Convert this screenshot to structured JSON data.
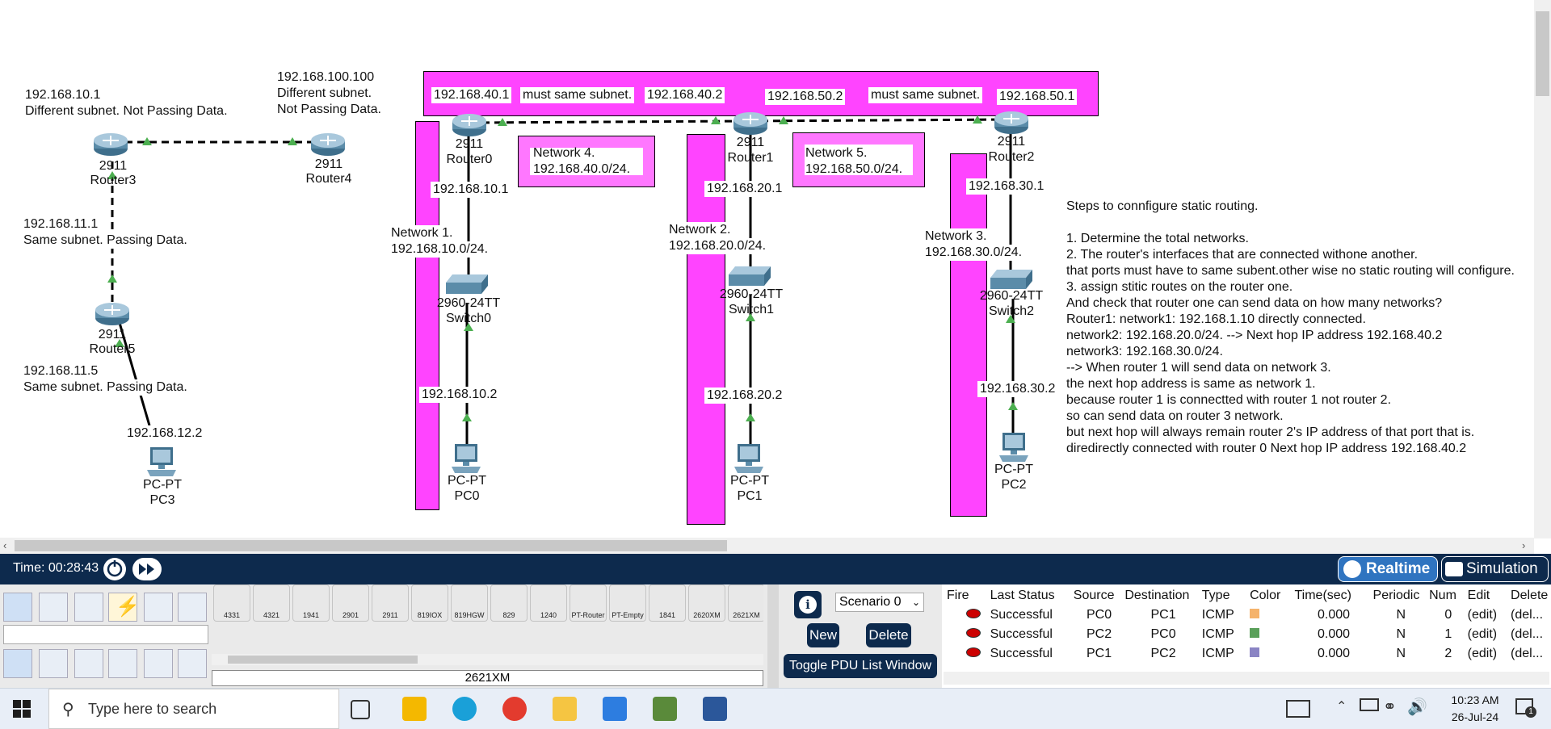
{
  "labels": {
    "r3_ip": "192.168.10.1",
    "r3_note": "Different subnet. Not Passing Data.",
    "r4_ip": "192.168.100.100",
    "r4_note1": "Different subnet.",
    "r4_note2": "Not Passing Data.",
    "r5_top_ip": "192.168.11.1",
    "r5_top_note": "Same subnet. Passing Data.",
    "r5_bot_ip": "192.168.11.5",
    "r5_bot_note": "Same subnet. Passing Data.",
    "pc3_ip": "192.168.12.2",
    "top_r0_ip": "192.168.40.1",
    "top_must1": "must same subnet.",
    "top_r1_ip_a": "192.168.40.2",
    "top_r1_ip_b": "192.168.50.2",
    "top_must2": "must same subnet.",
    "top_r2_ip": "192.168.50.1",
    "net4_line1": "Network 4.",
    "net4_line2": "192.168.40.0/24.",
    "net5_line1": "Network 5.",
    "net5_line2": "192.168.50.0/24.",
    "r0_down_ip": "192.168.10.1",
    "r1_down_ip": "192.168.20.1",
    "r2_down_ip": "192.168.30.1",
    "net1_line1": "Network 1.",
    "net1_line2": "192.168.10.0/24.",
    "net2_line1": "Network 2.",
    "net2_line2": "192.168.20.0/24.",
    "net3_line1": "Network 3.",
    "net3_line2": "192.168.30.0/24.",
    "pc0_ip": "192.168.10.2",
    "pc1_ip": "192.168.20.2",
    "pc2_ip": "192.168.30.2"
  },
  "devices": {
    "router3": {
      "model": "2911",
      "name": "Router3"
    },
    "router4": {
      "model": "2911",
      "name": "Router4"
    },
    "router5": {
      "model": "2911",
      "name": "Router5"
    },
    "router0": {
      "model": "2911",
      "name": "Router0"
    },
    "router1": {
      "model": "2911",
      "name": "Router1"
    },
    "router2": {
      "model": "2911",
      "name": "Router2"
    },
    "switch0": {
      "model": "2960-24TT",
      "name": "Switch0"
    },
    "switch1": {
      "model": "2960-24TT",
      "name": "Switch1"
    },
    "switch2": {
      "model": "2960-24TT",
      "name": "Switch2"
    },
    "pc0": {
      "model": "PC-PT",
      "name": "PC0"
    },
    "pc1": {
      "model": "PC-PT",
      "name": "PC1"
    },
    "pc2": {
      "model": "PC-PT",
      "name": "PC2"
    },
    "pc3": {
      "model": "PC-PT",
      "name": "PC3"
    }
  },
  "steps": [
    "Steps to connfigure static routing.",
    "",
    "1. Determine the total networks.",
    "2. The router's interfaces that are connected withone another.",
    "that ports must have to same subent.other wise no static routing will configure.",
    "3. assign stitic routes on the router one.",
    "And check that router one can send data on how many networks?",
    "Router1: network1: 192.168.1.10 directly connected.",
    "network2: 192.168.20.0/24. --> Next hop IP address 192.168.40.2",
    "network3: 192.168.30.0/24.",
    "--> When router 1 will send data on network 3.",
    "the next hop address is same as network 1.",
    " because router 1 is connectted with router 1 not router 2.",
    "so can send data on router 3 network.",
    "but next hop will always remain router 2's IP address of that port that is.",
    "diredirectly connected with router 0 Next hop IP address 192.168.40.2"
  ],
  "status": {
    "time_label": "Time: 00:28:43",
    "realtime": "Realtime",
    "simulation": "Simulation"
  },
  "device_models": [
    "4331",
    "4321",
    "1941",
    "2901",
    "2911",
    "819IOX",
    "819HGW",
    "829",
    "1240",
    "PT-Router",
    "PT-Empty",
    "1841",
    "2620XM",
    "2621XM"
  ],
  "selected_model": "2621XM",
  "scenario": {
    "select": "Scenario 0",
    "new": "New",
    "delete": "Delete",
    "toggle": "Toggle PDU List Window"
  },
  "pdu": {
    "headers": [
      "Fire",
      "Last Status",
      "Source",
      "Destination",
      "Type",
      "Color",
      "Time(sec)",
      "Periodic",
      "Num",
      "Edit",
      "Delete"
    ],
    "rows": [
      {
        "status": "Successful",
        "source": "PC0",
        "dest": "PC1",
        "type": "ICMP",
        "color": "#f5b36b",
        "time": "0.000",
        "periodic": "N",
        "num": "0",
        "edit": "(edit)",
        "del": "(del..."
      },
      {
        "status": "Successful",
        "source": "PC2",
        "dest": "PC0",
        "type": "ICMP",
        "color": "#5aa05a",
        "time": "0.000",
        "periodic": "N",
        "num": "1",
        "edit": "(edit)",
        "del": "(del..."
      },
      {
        "status": "Successful",
        "source": "PC1",
        "dest": "PC2",
        "type": "ICMP",
        "color": "#8a84c4",
        "time": "0.000",
        "periodic": "N",
        "num": "2",
        "edit": "(edit)",
        "del": "(del..."
      }
    ]
  },
  "taskbar": {
    "search_placeholder": "Type here to search",
    "time": "10:23 AM",
    "date": "26-Jul-24",
    "notification_count": "1"
  },
  "colors": {
    "magenta": "#ff44ff",
    "navy": "#0d2a4d",
    "link_arrow": "#4caf50"
  }
}
